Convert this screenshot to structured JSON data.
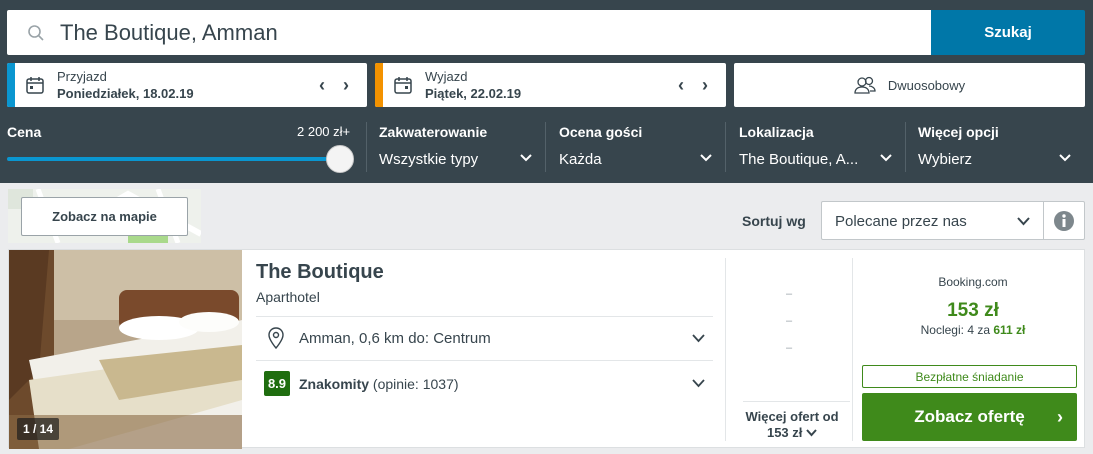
{
  "search": {
    "query": "The Boutique, Amman",
    "button_label": "Szukaj"
  },
  "dates": {
    "checkin": {
      "label": "Przyjazd",
      "value": "Poniedziałek, 18.02.19",
      "accent": "#0a96d0"
    },
    "checkout": {
      "label": "Wyjazd",
      "value": "Piątek, 22.02.19",
      "accent": "#f39200"
    }
  },
  "room": {
    "label": "Dwuosobowy"
  },
  "filters": {
    "price": {
      "label": "Cena",
      "max": "2 200 zł+"
    },
    "accommodation": {
      "label": "Zakwaterowanie",
      "value": "Wszystkie typy"
    },
    "rating": {
      "label": "Ocena gości",
      "value": "Każda"
    },
    "location": {
      "label": "Lokalizacja",
      "value": "The Boutique, A..."
    },
    "more": {
      "label": "Więcej opcji",
      "value": "Wybierz"
    }
  },
  "map": {
    "button_label": "Zobacz na mapie"
  },
  "sort": {
    "label": "Sortuj wg",
    "value": "Polecane przez nas"
  },
  "hotel": {
    "name": "The Boutique",
    "type": "Aparthotel",
    "location": "Amman, 0,6 km do: Centrum",
    "score": "8.9",
    "rating_word": "Znakomity",
    "reviews": "(opinie: 1037)",
    "photo_counter": "1 / 14",
    "more_offers": "Więcej ofert od",
    "more_offers_price": "153 zł",
    "provider": "Booking.com",
    "price": "153 zł",
    "nights_prefix": "Noclegi: 4 za",
    "nights_total": "611 zł",
    "breakfast": "Bezpłatne śniadanie",
    "deal_button": "Zobacz ofertę",
    "dashes": [
      "–",
      "–",
      "–"
    ]
  },
  "colors": {
    "header": "#37454d",
    "search_button": "#0077a8",
    "deal": "#3f8a1b",
    "score": "#1f6d0f"
  }
}
